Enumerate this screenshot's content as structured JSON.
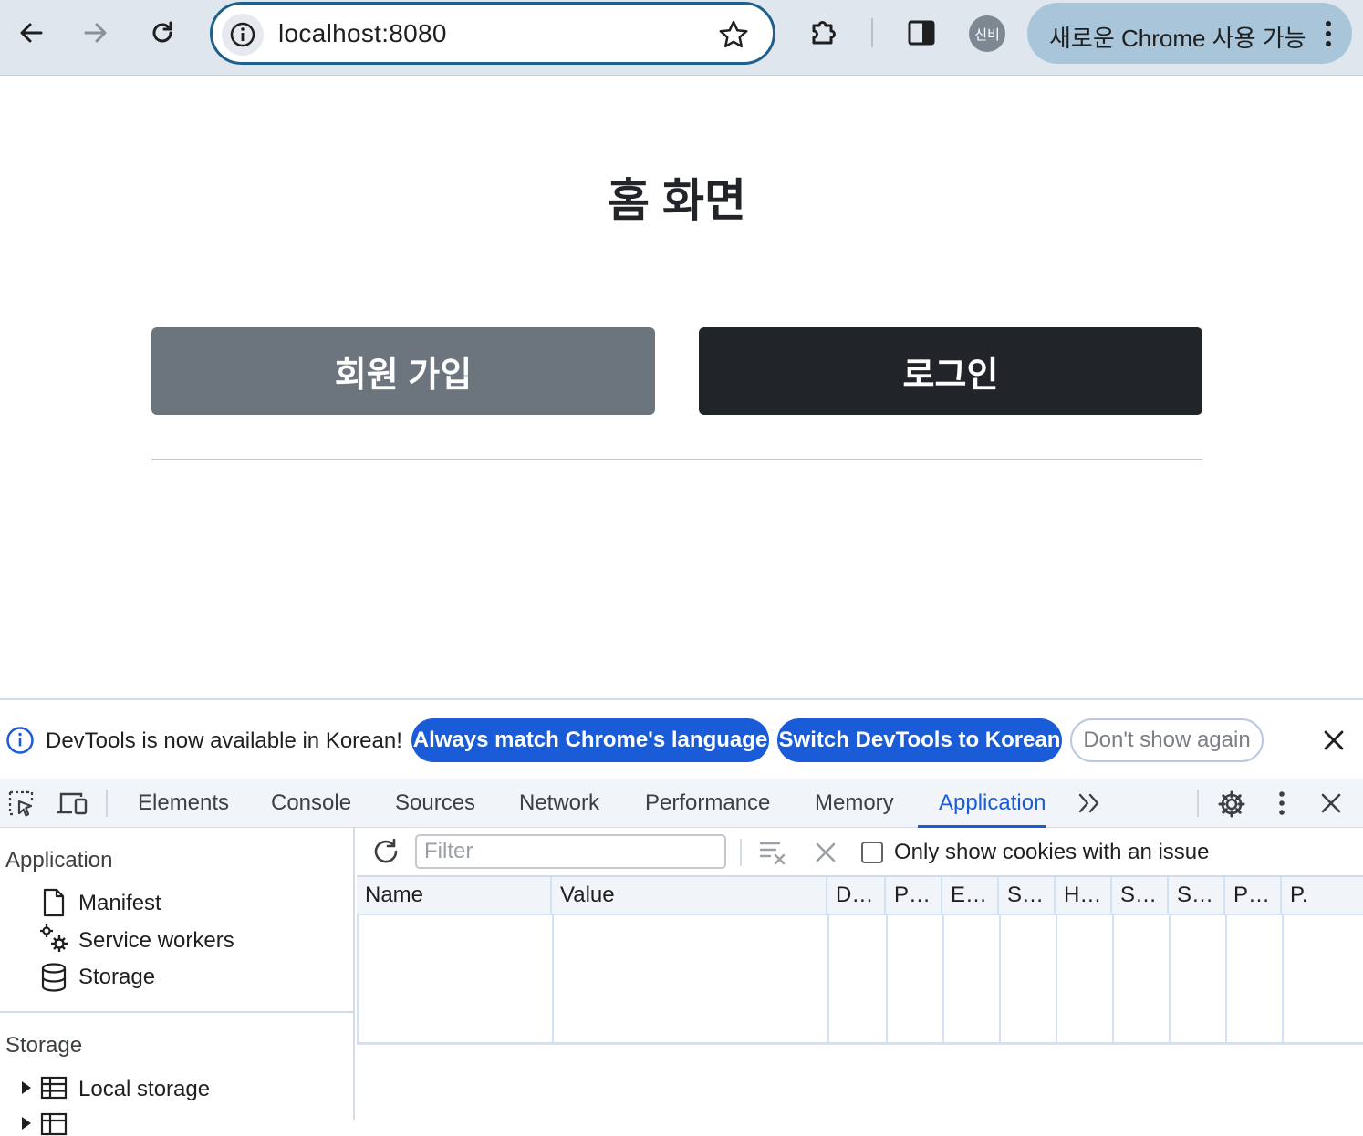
{
  "browser": {
    "url": "localhost:8080",
    "avatar_label": "신비",
    "update_label": "새로운 Chrome 사용 가능"
  },
  "page": {
    "title": "홈 화면",
    "signup_label": "회원 가입",
    "login_label": "로그인"
  },
  "devtools": {
    "infobar": {
      "message": "DevTools is now available in Korean!",
      "always_match_label": "Always match Chrome's language",
      "switch_label": "Switch DevTools to Korean",
      "dont_show_label": "Don't show again"
    },
    "tabs": [
      "Elements",
      "Console",
      "Sources",
      "Network",
      "Performance",
      "Memory",
      "Application"
    ],
    "active_tab": "Application",
    "sidebar": {
      "application_heading": "Application",
      "application_items": [
        "Manifest",
        "Service workers",
        "Storage"
      ],
      "storage_heading": "Storage",
      "storage_items": [
        "Local storage"
      ]
    },
    "cookies": {
      "filter_placeholder": "Filter",
      "only_issue_label": "Only show cookies with an issue",
      "columns": [
        "Name",
        "Value",
        "D…",
        "P…",
        "E…",
        "S…",
        "H…",
        "S…",
        "S…",
        "P…",
        "P."
      ]
    }
  },
  "colors": {
    "accent": "#1a5cd8",
    "secondary_button": "#6c757d",
    "dark_button": "#212529",
    "omnibox_border": "#1f5f8b"
  }
}
